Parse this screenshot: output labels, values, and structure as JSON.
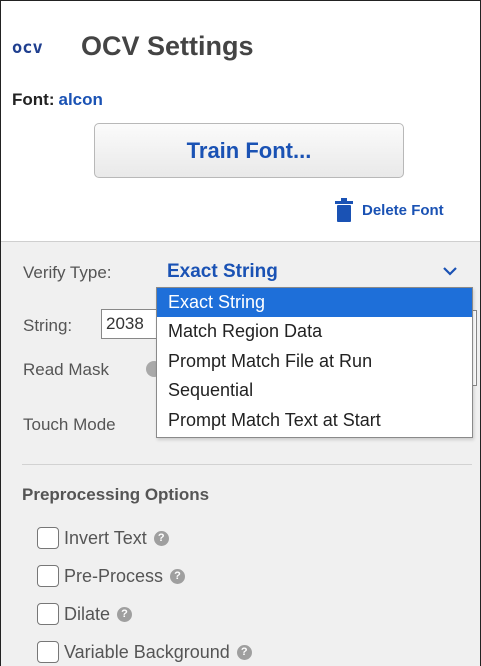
{
  "header": {
    "logo_text": "OCV",
    "title": "OCV Settings"
  },
  "font": {
    "label": "Font:",
    "value": "alcon"
  },
  "buttons": {
    "train_font": "Train Font...",
    "delete_font": "Delete Font"
  },
  "verify": {
    "label": "Verify Type:",
    "selected": "Exact String",
    "options": [
      "Exact String",
      "Match Region Data",
      "Prompt Match File at Run",
      "Sequential",
      "Prompt Match Text at Start"
    ],
    "highlighted_index": 0
  },
  "string": {
    "label": "String:",
    "value": "2038"
  },
  "read_mask": {
    "label": "Read Mask"
  },
  "touch_mode": {
    "label": "Touch Mode"
  },
  "preprocessing": {
    "title": "Preprocessing Options",
    "options": [
      {
        "label": "Invert Text",
        "checked": false
      },
      {
        "label": "Pre-Process",
        "checked": false
      },
      {
        "label": "Dilate",
        "checked": false
      },
      {
        "label": "Variable Background",
        "checked": false
      }
    ],
    "help_glyph": "?"
  },
  "colors": {
    "link_blue": "#1a52b4",
    "highlight": "#1e6fd9",
    "panel_bg": "#f0f0f0"
  }
}
